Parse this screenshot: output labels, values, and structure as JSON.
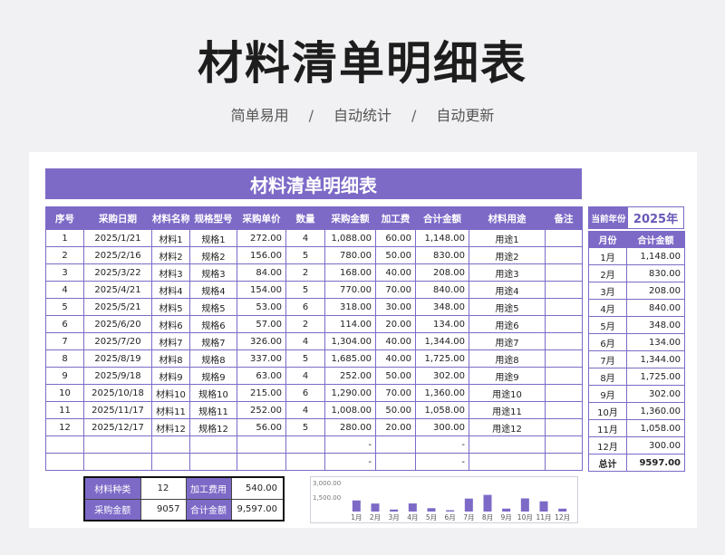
{
  "hero": {
    "title": "材料清单明细表",
    "tag1": "简单易用",
    "tag2": "自动统计",
    "tag3": "自动更新",
    "separator": "/"
  },
  "sheet": {
    "banner": "材料清单明细表",
    "headers": [
      "序号",
      "采购日期",
      "材料名称",
      "规格型号",
      "采购单价",
      "数量",
      "采购金额",
      "加工费",
      "合计金额",
      "材料用途",
      "备注"
    ],
    "rows": [
      [
        "1",
        "2025/1/21",
        "材料1",
        "规格1",
        "272.00",
        "4",
        "1,088.00",
        "60.00",
        "1,148.00",
        "用途1",
        ""
      ],
      [
        "2",
        "2025/2/16",
        "材料2",
        "规格2",
        "156.00",
        "5",
        "780.00",
        "50.00",
        "830.00",
        "用途2",
        ""
      ],
      [
        "3",
        "2025/3/22",
        "材料3",
        "规格3",
        "84.00",
        "2",
        "168.00",
        "40.00",
        "208.00",
        "用途3",
        ""
      ],
      [
        "4",
        "2025/4/21",
        "材料4",
        "规格4",
        "154.00",
        "5",
        "770.00",
        "70.00",
        "840.00",
        "用途4",
        ""
      ],
      [
        "5",
        "2025/5/21",
        "材料5",
        "规格5",
        "53.00",
        "6",
        "318.00",
        "30.00",
        "348.00",
        "用途5",
        ""
      ],
      [
        "6",
        "2025/6/20",
        "材料6",
        "规格6",
        "57.00",
        "2",
        "114.00",
        "20.00",
        "134.00",
        "用途6",
        ""
      ],
      [
        "7",
        "2025/7/20",
        "材料7",
        "规格7",
        "326.00",
        "4",
        "1,304.00",
        "40.00",
        "1,344.00",
        "用途7",
        ""
      ],
      [
        "8",
        "2025/8/19",
        "材料8",
        "规格8",
        "337.00",
        "5",
        "1,685.00",
        "40.00",
        "1,725.00",
        "用途8",
        ""
      ],
      [
        "9",
        "2025/9/18",
        "材料9",
        "规格9",
        "63.00",
        "4",
        "252.00",
        "50.00",
        "302.00",
        "用途9",
        ""
      ],
      [
        "10",
        "2025/10/18",
        "材料10",
        "规格10",
        "215.00",
        "6",
        "1,290.00",
        "70.00",
        "1,360.00",
        "用途10",
        ""
      ],
      [
        "11",
        "2025/11/17",
        "材料11",
        "规格11",
        "252.00",
        "4",
        "1,008.00",
        "50.00",
        "1,058.00",
        "用途11",
        ""
      ],
      [
        "12",
        "2025/12/17",
        "材料12",
        "规格12",
        "56.00",
        "5",
        "280.00",
        "20.00",
        "300.00",
        "用途12",
        ""
      ],
      [
        "",
        "",
        "",
        "",
        "",
        "",
        "-",
        "",
        "-",
        "",
        ""
      ],
      [
        "",
        "",
        "",
        "",
        "",
        "",
        "-",
        "",
        "-",
        "",
        ""
      ]
    ]
  },
  "side": {
    "year_label": "当前年份",
    "year_value": "2025年",
    "month_header": "月份",
    "amount_header": "合计金额",
    "rows": [
      [
        "1月",
        "1,148.00"
      ],
      [
        "2月",
        "830.00"
      ],
      [
        "3月",
        "208.00"
      ],
      [
        "4月",
        "840.00"
      ],
      [
        "5月",
        "348.00"
      ],
      [
        "6月",
        "134.00"
      ],
      [
        "7月",
        "1,344.00"
      ],
      [
        "8月",
        "1,725.00"
      ],
      [
        "9月",
        "302.00"
      ],
      [
        "10月",
        "1,360.00"
      ],
      [
        "11月",
        "1,058.00"
      ],
      [
        "12月",
        "300.00"
      ]
    ],
    "total_label": "总计",
    "total_value": "9597.00"
  },
  "summary": {
    "material_types_label": "材料种类",
    "material_types_value": "12",
    "processing_fee_label": "加工费用",
    "processing_fee_value": "540.00",
    "purchase_amount_label": "采购金额",
    "purchase_amount_value": "9057",
    "total_amount_label": "合计金额",
    "total_amount_value": "9,597.00"
  },
  "chart_data": {
    "type": "bar",
    "categories": [
      "1月",
      "2月",
      "3月",
      "4月",
      "5月",
      "6月",
      "7月",
      "8月",
      "9月",
      "10月",
      "11月",
      "12月"
    ],
    "values": [
      1148,
      830,
      208,
      840,
      348,
      134,
      1344,
      1725,
      302,
      1360,
      1058,
      300
    ],
    "yticks": [
      "3,000.00",
      "1,500.00"
    ],
    "ylim": [
      0,
      3000
    ],
    "color": "#7d6ac7"
  },
  "colors": {
    "accent": "#7d6ac7",
    "year_text": "#6a58b8"
  }
}
